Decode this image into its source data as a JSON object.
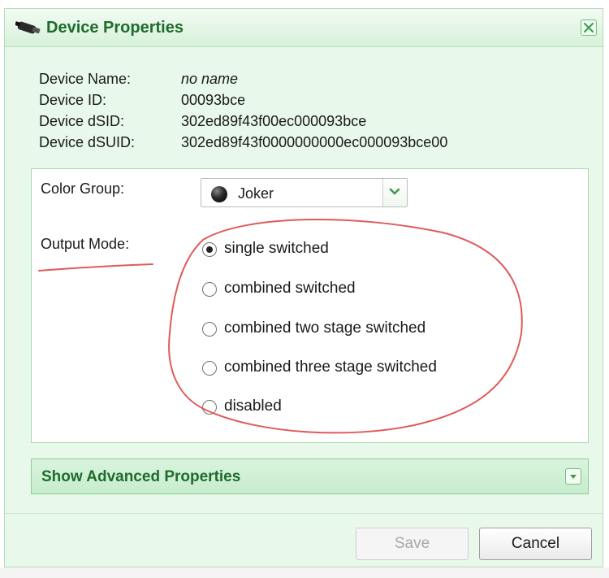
{
  "dialog": {
    "title": "Device Properties",
    "icons": {
      "title": "device-icon",
      "close": "close-icon"
    }
  },
  "device_info": [
    {
      "label": "Device Name:",
      "value": "no name"
    },
    {
      "label": "Device ID:",
      "value": "00093bce"
    },
    {
      "label": "Device dSID:",
      "value": "302ed89f43f00ec000093bce"
    },
    {
      "label": "Device dSUID:",
      "value": "302ed89f43f0000000000ec000093bce00"
    }
  ],
  "properties": {
    "color_group": {
      "label": "Color Group:",
      "selected": "Joker",
      "icon": "black-ball-icon"
    },
    "output_mode": {
      "label": "Output Mode:",
      "options": [
        {
          "label": "single switched",
          "checked": true
        },
        {
          "label": "combined switched",
          "checked": false
        },
        {
          "label": "combined two stage switched",
          "checked": false
        },
        {
          "label": "combined three stage switched",
          "checked": false
        },
        {
          "label": "disabled",
          "checked": false
        }
      ]
    }
  },
  "advanced": {
    "label": "Show Advanced Properties"
  },
  "buttons": {
    "save": "Save",
    "cancel": "Cancel"
  },
  "colors": {
    "accent": "#1f6b2d",
    "dialog_bg": "#e8f8ea",
    "border": "#a8d8ad",
    "annotation": "#e05a5a"
  }
}
